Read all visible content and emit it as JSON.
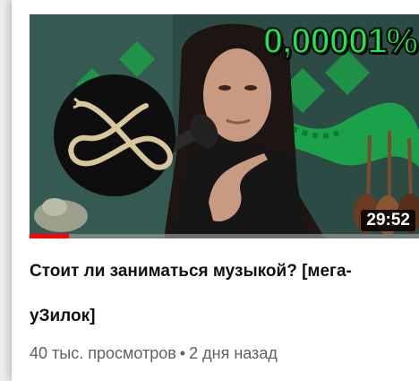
{
  "video": {
    "overlay_text": "0,00001%",
    "duration": "29:52",
    "watched_fraction": 0.1,
    "title": "Стоит ли заниматься музыкой? [мега-уЗилок]",
    "views": "40 тыс. просмотров",
    "separator": "•",
    "age": "2 дня назад"
  },
  "colors": {
    "overlay_text": "#1fe84e",
    "progress": "#ff0000",
    "wall": "#2c4a44",
    "panel_accent": "#1fa84a"
  }
}
